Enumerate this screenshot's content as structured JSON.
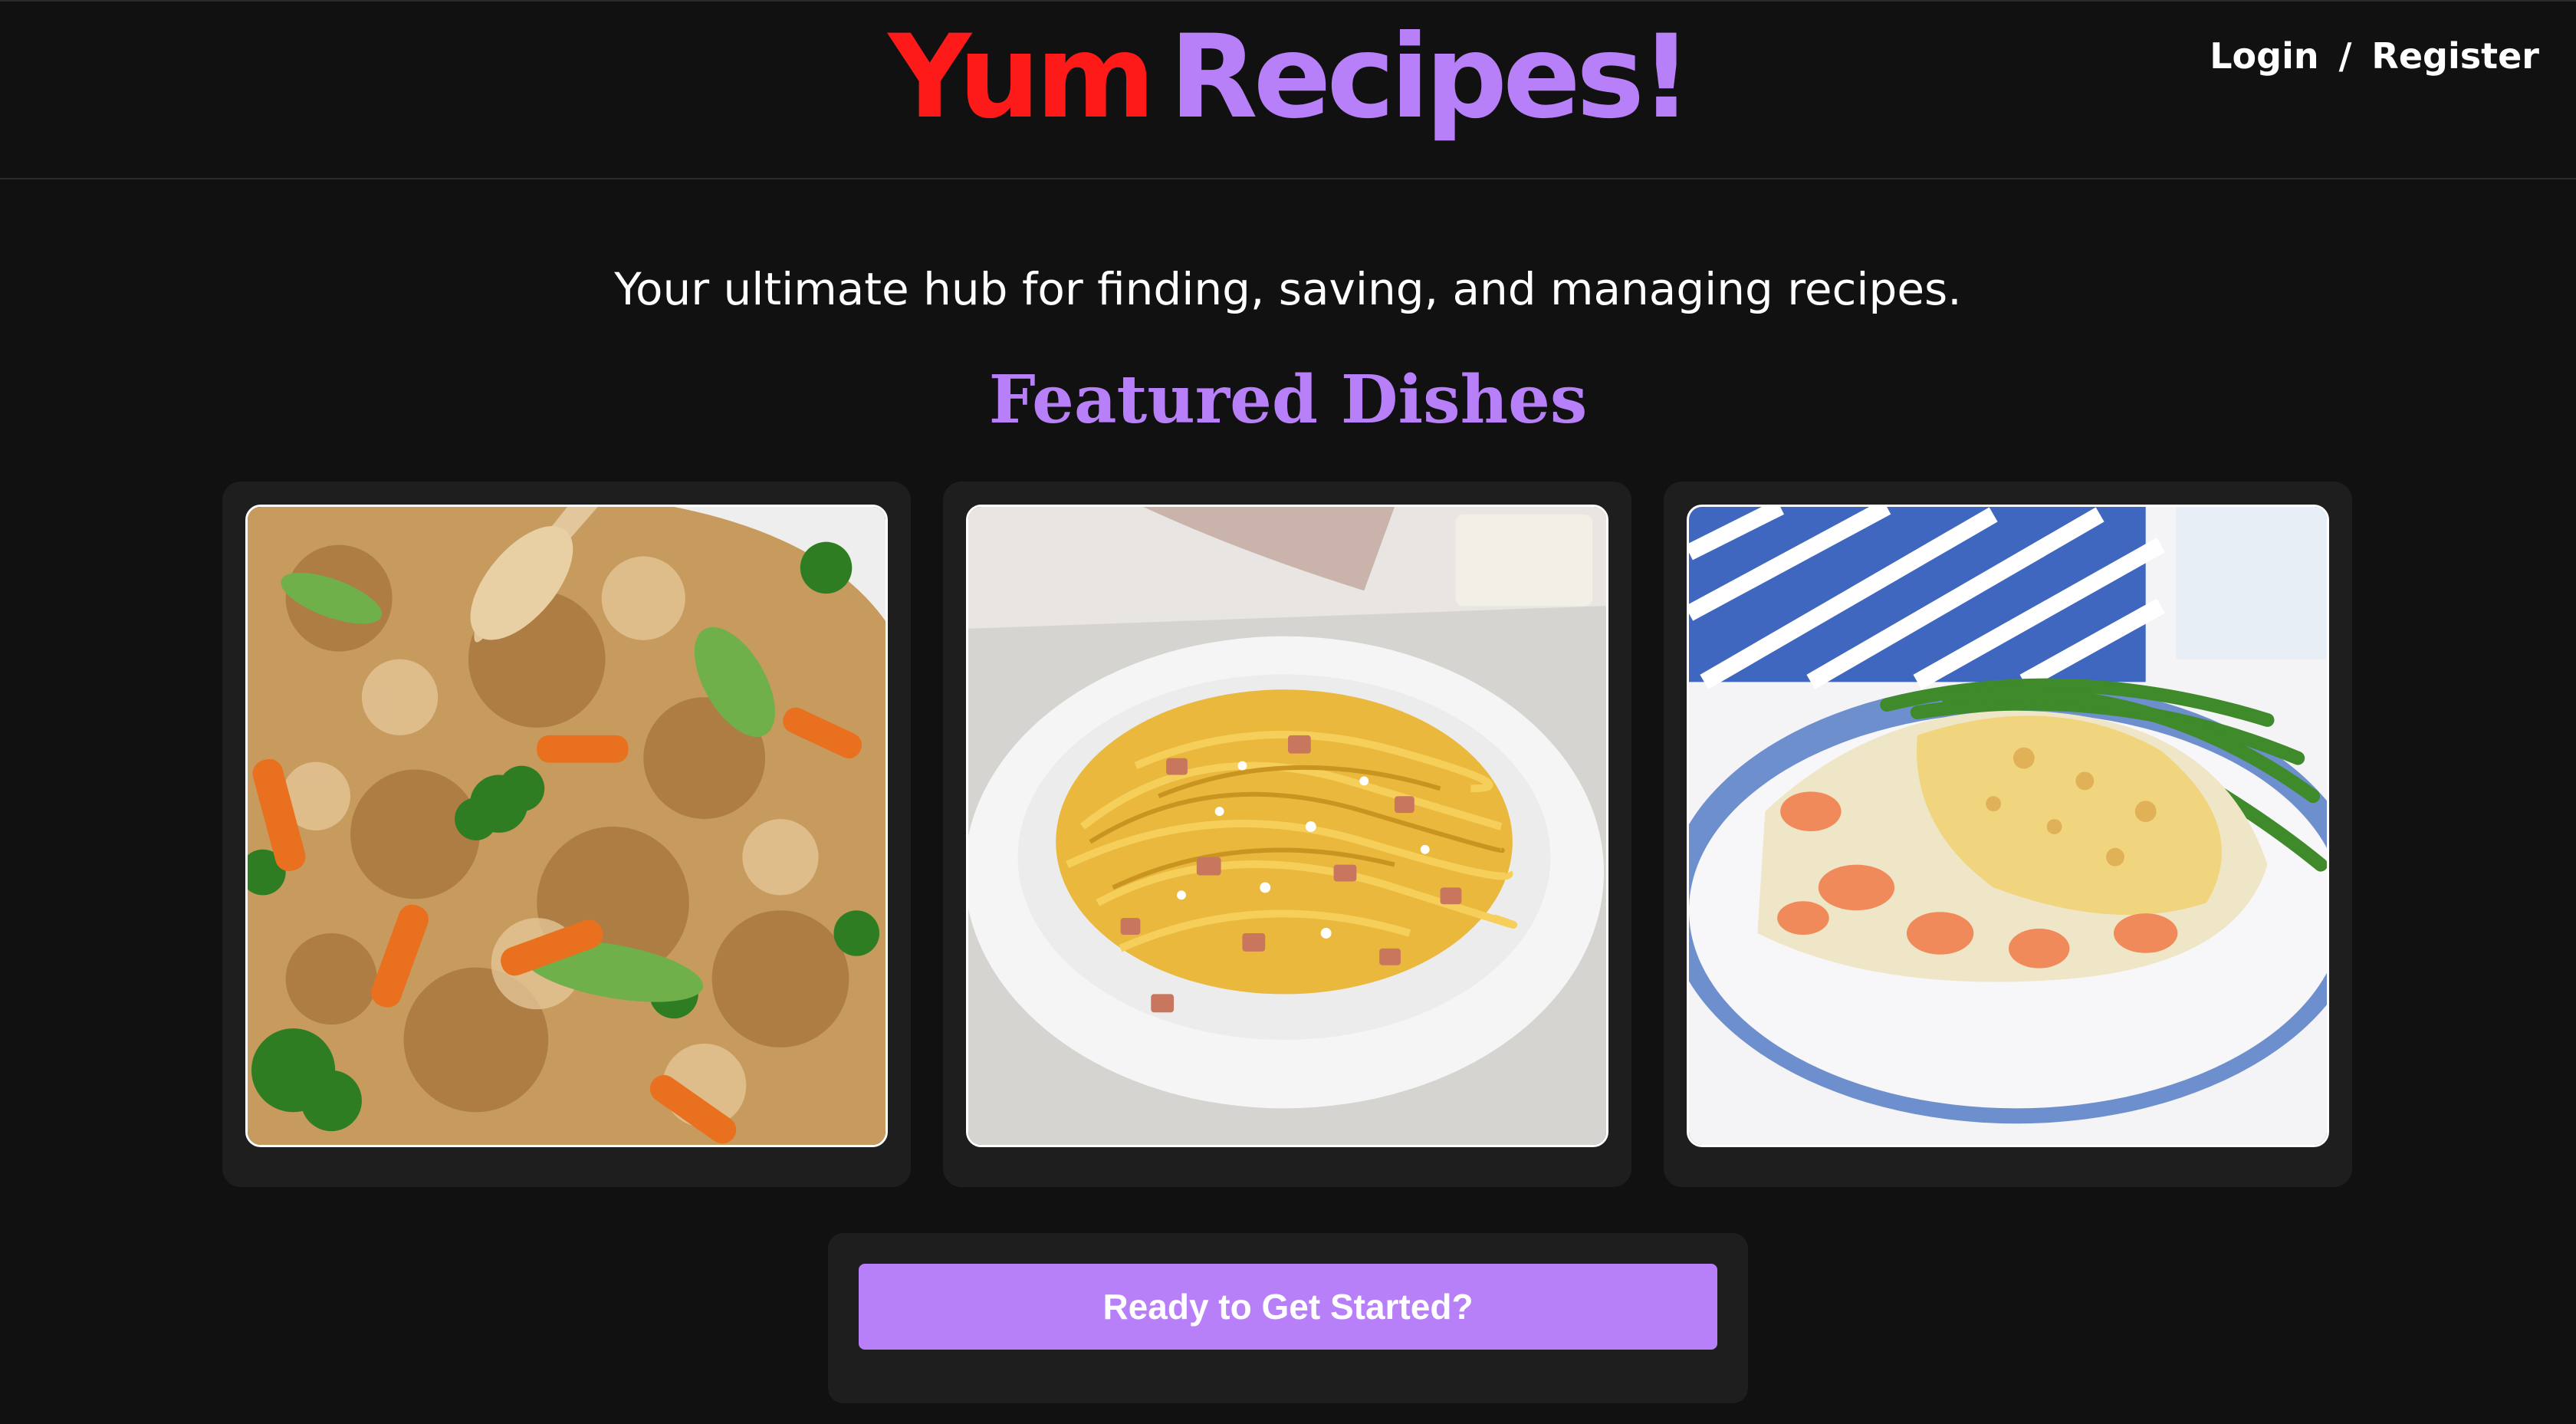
{
  "header": {
    "logo_part1": "Yum",
    "logo_part2": "Recipes!",
    "login_label": "Login",
    "separator": "/",
    "register_label": "Register"
  },
  "hero": {
    "tagline": "Your ultimate hub for finding, saving, and managing recipes.",
    "section_title": "Featured Dishes"
  },
  "featured": [
    {
      "image": "chicken-fried-rice-photo"
    },
    {
      "image": "spaghetti-carbonara-photo"
    },
    {
      "image": "fish-pie-with-green-beans-photo"
    }
  ],
  "cta": {
    "label": "Ready to Get Started?"
  },
  "colors": {
    "background": "#111111",
    "card": "#1e1e1f",
    "accent": "#b77ff8",
    "logo_red": "#ff1a1a"
  }
}
